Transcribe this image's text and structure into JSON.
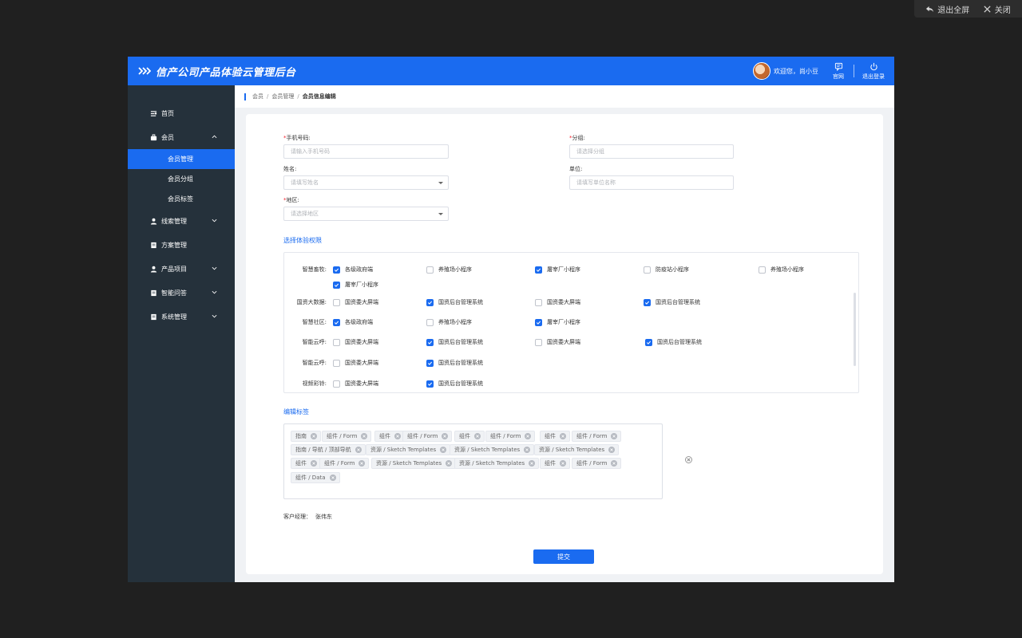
{
  "viewer": {
    "exit_fullscreen": "退出全屏",
    "close": "关闭"
  },
  "header": {
    "title": "信产公司产品体验云管理后台",
    "welcome": "欢迎您，尚小豆",
    "official_site": "官网",
    "logout": "退出登录",
    "brand_color": "#1a6bf0"
  },
  "sidebar": {
    "home": "首页",
    "member": "会员",
    "member_manage": "会员管理",
    "member_group": "会员分组",
    "member_tag": "会员标签",
    "leads": "线索管理",
    "plans": "方案管理",
    "products": "产品项目",
    "qa": "智能问答",
    "system": "系统管理"
  },
  "breadcrumb": {
    "l1": "会员",
    "sep": "/",
    "l2": "会员管理",
    "current": "会员信息编辑"
  },
  "form": {
    "phone_label": "手机号码:",
    "phone_placeholder": "请输入手机号码",
    "group_label": "分组:",
    "group_placeholder": "请选择分组",
    "name_label": "姓名:",
    "name_placeholder": "请填写姓名",
    "unit_label": "单位:",
    "unit_placeholder": "请填写单位名称",
    "region_label": "地区:",
    "region_placeholder": "请选择地区",
    "required_mark": "*"
  },
  "permissions": {
    "section_title": "选择体验权限",
    "rows": [
      {
        "label": "智慧畜牧:"
      },
      {
        "label": "国资大数据:"
      },
      {
        "label": "智慧社区:"
      },
      {
        "label": "智能云呼:"
      },
      {
        "label": "智能云呼:"
      },
      {
        "label": "视频彩铃:"
      }
    ],
    "options": {
      "gov_end": "各级政府端",
      "farm_mini": "养殖场小程序",
      "slaughter_mini": "屠宰厂小程序",
      "epidemic_mini": "防疫站小程序",
      "big_screen": "国资委大屏端",
      "backend": "国资后台管理系统"
    }
  },
  "tags": {
    "section_title": "编辑标签",
    "items": [
      "指南",
      "组件 / Form",
      "组件",
      "组件 / Form",
      "组件",
      "组件 / Form",
      "组件",
      "组件 / Form",
      "指南 / 导航 / 顶部导航",
      "资源 / Sketch Templates",
      "资源 / Sketch Templates",
      "资源 / Sketch Templates",
      "组件",
      "组件 / Form",
      "资源 / Sketch Templates",
      "资源 / Sketch Templates",
      "组件",
      "组件 / Form",
      "组件 / Data"
    ]
  },
  "manager": {
    "label": "客户经理：",
    "value": "张伟东"
  },
  "submit_label": "提交"
}
